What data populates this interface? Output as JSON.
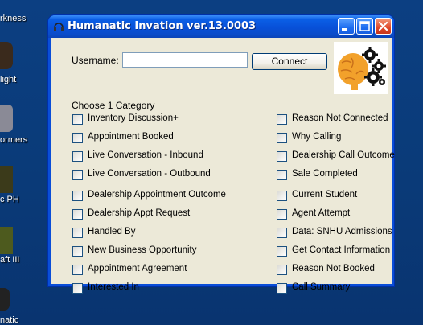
{
  "desktop": {
    "icons": [
      {
        "label": "rkness"
      },
      {
        "label": "light"
      },
      {
        "label": "ormers"
      },
      {
        "label": "c PH"
      },
      {
        "label": "aft III"
      },
      {
        "label": "natic"
      }
    ]
  },
  "window": {
    "title": "Humanatic Invation ver.13.0003",
    "username_label": "Username:",
    "username_value": "",
    "connect_label": "Connect",
    "choose_label": "Choose 1 Category",
    "categories_left": [
      "Inventory Discussion+",
      "Appointment Booked",
      "Live Conversation - Inbound",
      "Live Conversation - Outbound",
      "Dealership Appointment Outcome",
      "Dealership Appt Request",
      "Handled By",
      "New Business Opportunity",
      "Appointment Agreement",
      "Interested In"
    ],
    "categories_right": [
      "Reason Not Connected",
      "Why Calling",
      "Dealership Call Outcome",
      "Sale Completed",
      "Current Student",
      "Agent Attempt",
      "Data: SNHU Admissions",
      "Get Contact Information",
      "Reason Not Booked",
      "Call Summary"
    ],
    "colors": {
      "titlebar": "#0a4ed8",
      "client": "#ece9d8",
      "close_button": "#e0482a"
    }
  }
}
